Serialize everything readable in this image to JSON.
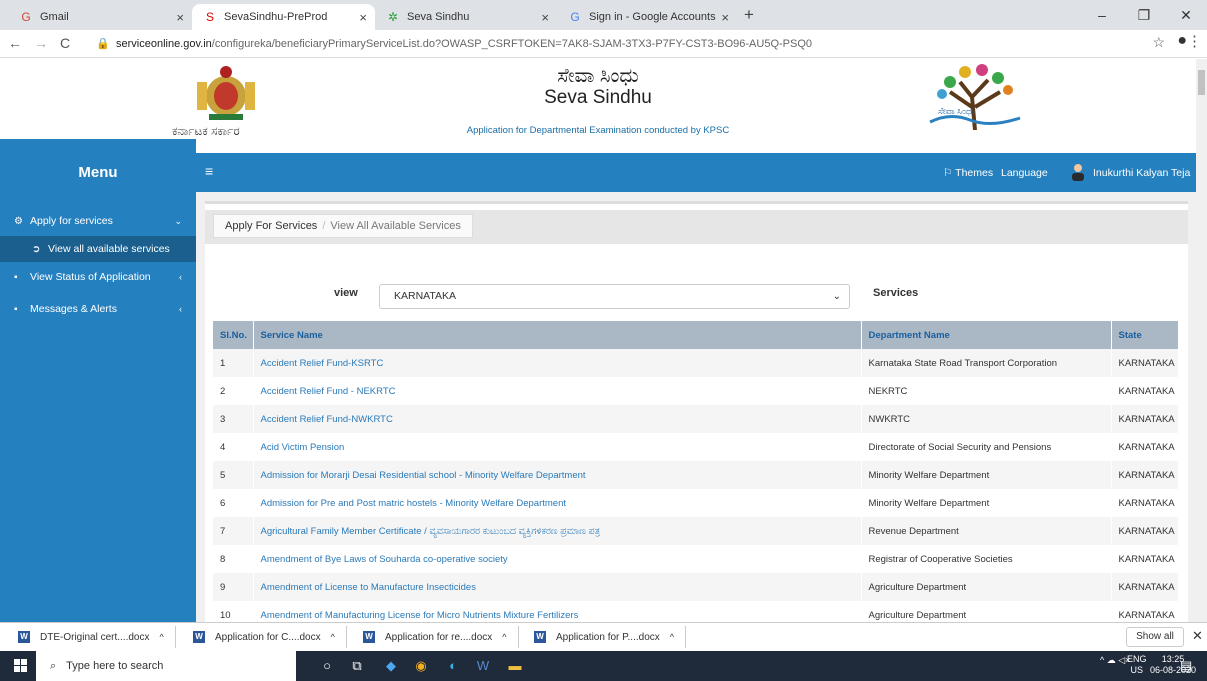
{
  "browser": {
    "tabs": [
      {
        "title": "Gmail",
        "icon": "gmail-icon",
        "fav": "G",
        "color": "#d44638"
      },
      {
        "title": "SevaSindhu-PreProd",
        "icon": "seva-sindhu-icon",
        "fav": "S",
        "color": "#d00"
      },
      {
        "title": "Seva Sindhu",
        "icon": "seva-sindhu-icon",
        "fav": "✲",
        "color": "#2a9d3a"
      },
      {
        "title": "Sign in - Google Accounts",
        "icon": "google-icon",
        "fav": "G",
        "color": "#4285f4"
      }
    ],
    "url_host": "serviceonline.gov.in",
    "url_path": "/configureka/beneficiaryPrimaryServiceList.do?OWASP_CSRFTOKEN=7AK8-SJAM-3TX3-P7FY-CST3-BO96-AU5Q-PSQ0"
  },
  "header": {
    "gov_text": "ಕರ್ನಾಟಕ ಸರ್ಕಾರ",
    "title_kn": "ಸೇವಾ ಸಿಂಧು",
    "title_en": "Seva Sindhu",
    "subtitle": "Application for Departmental Examination conducted by KPSC",
    "logo_text": "ಸೇವಾ ಸಿಂಧು"
  },
  "topbar": {
    "menu": "Menu",
    "themes": "Themes",
    "language": "Language",
    "user": "Inukurthi Kalyan Teja"
  },
  "sidebar": {
    "apply": "Apply for services",
    "view_all": "View all available services",
    "status": "View Status of Application",
    "messages": "Messages & Alerts"
  },
  "breadcrumb": {
    "first": "Apply For Services",
    "sep": "/",
    "second": "View All Available Services"
  },
  "filter": {
    "view_label": "view",
    "selected": "KARNATAKA",
    "services_label": "Services"
  },
  "table": {
    "headers": [
      "Sl.No.",
      "Service Name",
      "Department Name",
      "State"
    ],
    "rows": [
      [
        "1",
        "Accident Relief Fund-KSRTC",
        "Karnataka State Road Transport Corporation",
        "KARNATAKA"
      ],
      [
        "2",
        "Accident Relief Fund - NEKRTC",
        "NEKRTC",
        "KARNATAKA"
      ],
      [
        "3",
        "Accident Relief Fund-NWKRTC",
        "NWKRTC",
        "KARNATAKA"
      ],
      [
        "4",
        "Acid Victim Pension",
        "Directorate of Social Security and Pensions",
        "KARNATAKA"
      ],
      [
        "5",
        "Admission for Morarji Desai Residential school - Minority Welfare Department",
        "Minority Welfare Department",
        "KARNATAKA"
      ],
      [
        "6",
        "Admission for Pre and Post matric hostels - Minority Welfare Department",
        "Minority Welfare Department",
        "KARNATAKA"
      ],
      [
        "7",
        "Agricultural Family Member Certificate / ವ್ಯವಸಾಯಗಾರರ ಕುಟುಂಬದ ವ್ಯಕ್ತಿಗಳಿಕರಣ ಪ್ರಮಾಣ ಪತ್ರ",
        "Revenue Department",
        "KARNATAKA"
      ],
      [
        "8",
        "Amendment of Bye Laws of Souharda co-operative society",
        "Registrar of Cooperative Societies",
        "KARNATAKA"
      ],
      [
        "9",
        "Amendment of License to Manufacture Insecticides",
        "Agriculture Department",
        "KARNATAKA"
      ],
      [
        "10",
        "Amendment of Manufacturing License for Micro Nutrients Mixture Fertilizers",
        "Agriculture Department",
        "KARNATAKA"
      ]
    ]
  },
  "downloads": {
    "items": [
      "DTE-Original cert....docx",
      "Application for C....docx",
      "Application for re....docx",
      "Application for P....docx"
    ],
    "show_all": "Show all"
  },
  "taskbar": {
    "search": "Type here to search",
    "lang1": "ENG",
    "lang2": "US",
    "time": "13:25",
    "date": "06-08-2020"
  }
}
